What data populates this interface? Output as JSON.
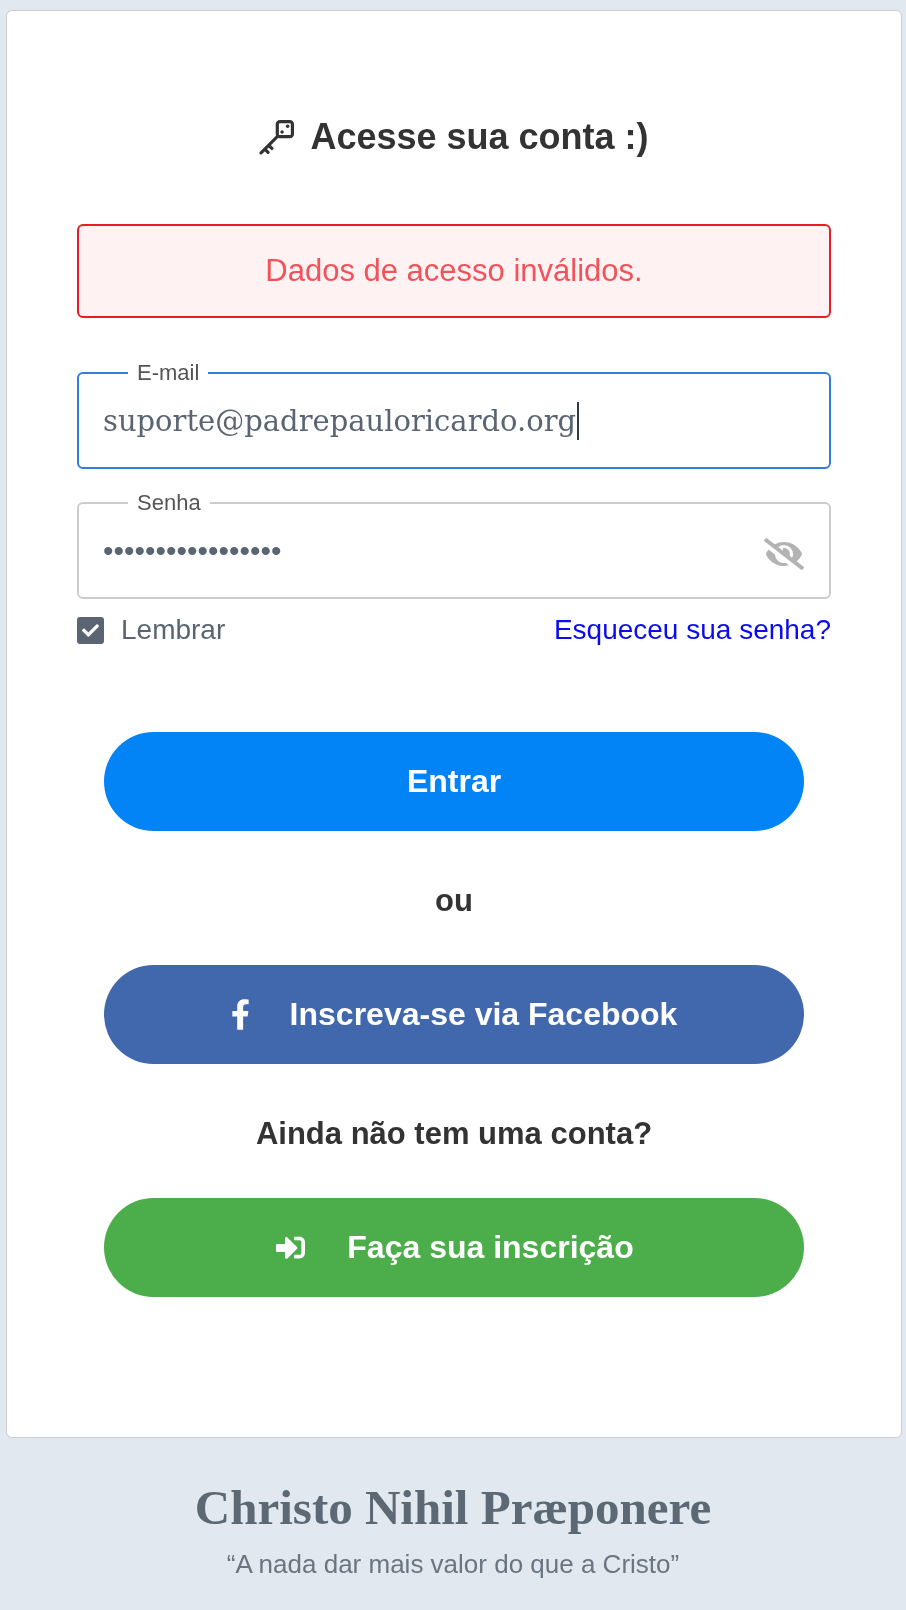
{
  "header": {
    "title": "Acesse sua conta :)"
  },
  "alert": {
    "kind": "error",
    "message": "Dados de acesso inválidos."
  },
  "fields": [
    {
      "kind": "text",
      "label": "E-mail",
      "value": "suporte@padrepauloricardo.org",
      "focused": true
    },
    {
      "kind": "password",
      "label": "Senha",
      "value": "•••••••••••••••••",
      "focused": false,
      "revealed": false
    }
  ],
  "remember": {
    "label": "Lembrar",
    "checked": true
  },
  "forgot_link": "Esqueceu sua senha?",
  "login_button": "Entrar",
  "divider": "ou",
  "facebook_button": "Inscreva-se via Facebook",
  "signup_prompt": "Ainda não tem uma conta?",
  "signup_button": "Faça sua inscrição",
  "footer": {
    "motto": "Christo Nihil Præponere",
    "translation": "“A nada dar mais valor do que a Cristo”"
  }
}
